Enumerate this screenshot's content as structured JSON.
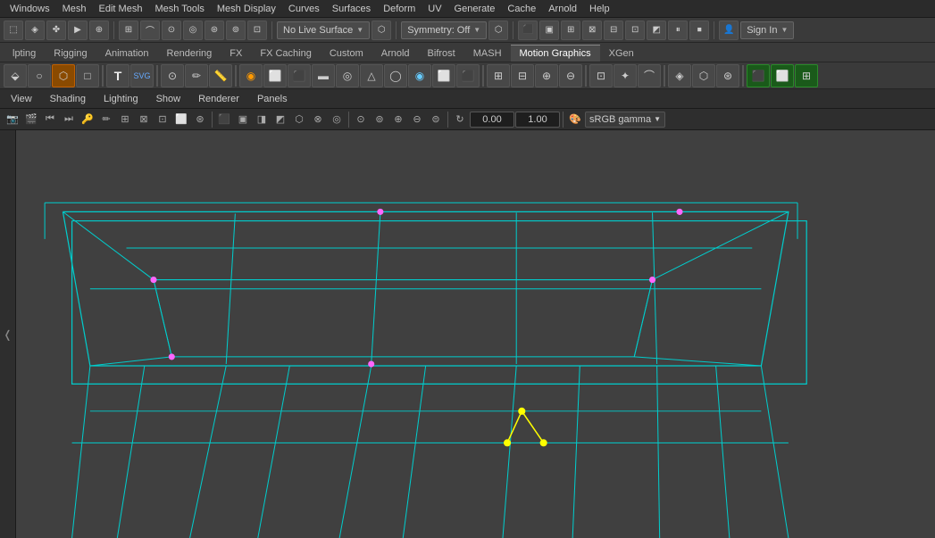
{
  "menu": {
    "items": [
      "Windows",
      "Mesh",
      "Edit Mesh",
      "Mesh Tools",
      "Mesh Display",
      "Curves",
      "Surfaces",
      "Deform",
      "UV",
      "Generate",
      "Cache",
      "Arnold",
      "Help"
    ]
  },
  "toolbar1": {
    "live_surface_label": "No Live Surface",
    "symmetry_label": "Symmetry: Off",
    "sign_in_label": "Sign In"
  },
  "shelf_tabs": {
    "tabs": [
      "lpting",
      "Rigging",
      "Animation",
      "Rendering",
      "FX",
      "FX Caching",
      "Custom",
      "Arnold",
      "Bifrost",
      "MASH",
      "Motion Graphics",
      "XGen"
    ]
  },
  "viewport_header": {
    "menus": [
      "View",
      "Shading",
      "Lighting",
      "Show",
      "Renderer",
      "Panels"
    ]
  },
  "viewport_icons": {
    "value1": "0.00",
    "value2": "1.00",
    "color_space": "sRGB gamma"
  }
}
